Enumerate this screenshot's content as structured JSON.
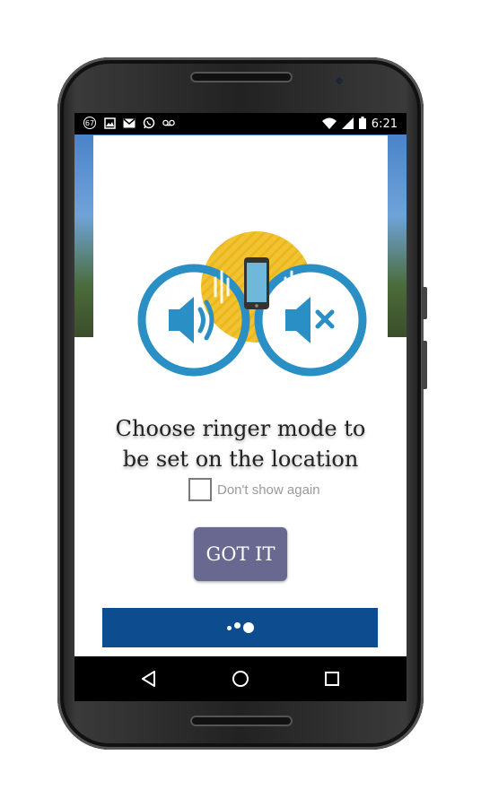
{
  "status_bar": {
    "notification_badge": "67",
    "icons_left": [
      "notification-count-icon",
      "image-icon",
      "gmail-icon",
      "whatsapp-icon",
      "voicemail-icon"
    ],
    "icons_right": [
      "wifi-icon",
      "signal-icon",
      "battery-icon"
    ],
    "time": "6:21"
  },
  "dialog": {
    "title_line1": "Choose ringer mode to",
    "title_line2": "be set on the location",
    "checkbox_label": "Don't show again",
    "checkbox_checked": false,
    "button_label": "GOT IT",
    "illustration": [
      "sound-on-icon",
      "phone-vibrate-icon",
      "sound-muted-icon"
    ]
  },
  "nav_bar": {
    "icons": [
      "back-icon",
      "home-icon",
      "recents-icon"
    ]
  },
  "colors": {
    "ring_blue": "#2a8fc4",
    "vibrate_yellow": "#f2c230",
    "button_bg": "#686890",
    "progress_bar": "#0d4c8f"
  }
}
